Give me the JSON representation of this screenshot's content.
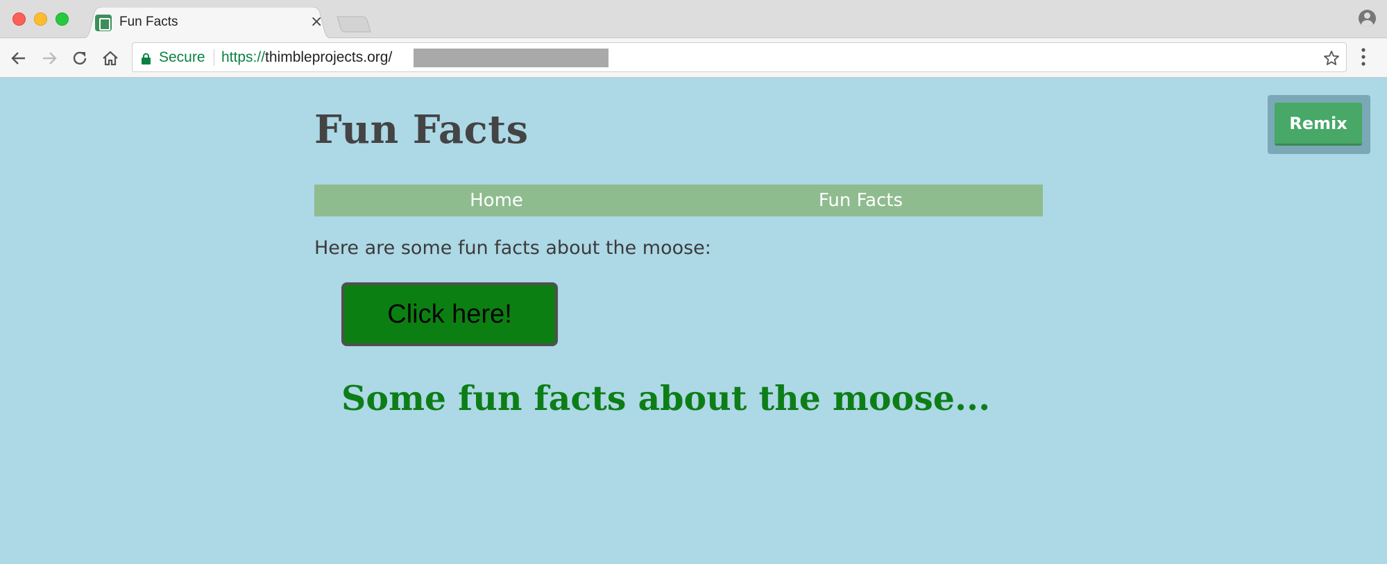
{
  "browser": {
    "tab_title": "Fun Facts",
    "tab_close": "×",
    "secure_label": "Secure",
    "url_scheme": "https://",
    "url_host": "thimbleprojects.org/"
  },
  "page": {
    "title": "Fun Facts",
    "nav": [
      {
        "label": "Home"
      },
      {
        "label": "Fun Facts"
      }
    ],
    "intro": "Here are some fun facts about the moose:",
    "button_label": "Click here!",
    "heading": "Some fun facts about the moose...",
    "remix_label": "Remix"
  },
  "colors": {
    "background": "#add8e6",
    "nav_bg": "#8fbc8f",
    "button_bg": "#0c7f12",
    "heading": "#0d7e17",
    "remix": "#47a867"
  }
}
